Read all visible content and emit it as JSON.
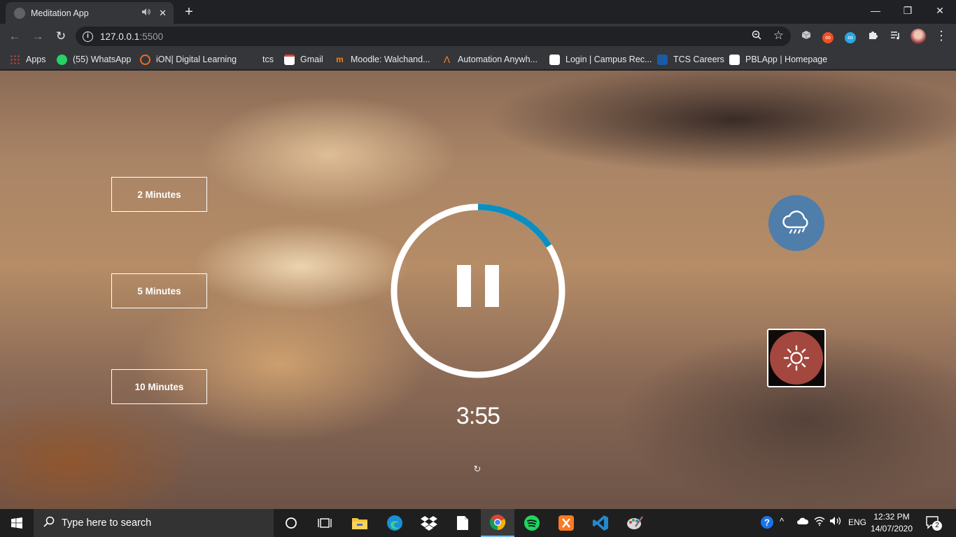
{
  "browser": {
    "tab_title": "Meditation App",
    "tab_audio_icon": "speaker-icon",
    "tab_close_glyph": "✕",
    "new_tab_glyph": "+",
    "window_controls": {
      "minimize": "—",
      "restore": "❐",
      "close": "✕"
    },
    "url_host": "127.0.0.1",
    "url_port": ":5500",
    "bookmarks": [
      {
        "label": "Apps",
        "color": "#e0e0e0"
      },
      {
        "label": "(55) WhatsApp",
        "color": "#25d366"
      },
      {
        "label": "iON| Digital Learning",
        "color": "#f26b21"
      },
      {
        "label": "tcs",
        "color": "#35363a"
      },
      {
        "label": "Gmail",
        "color": "#ea4335"
      },
      {
        "label": "Moodle: Walchand...",
        "color": "#f98012"
      },
      {
        "label": "Automation Anywh...",
        "color": "#f58220"
      },
      {
        "label": "Login | Campus Rec...",
        "color": "#ffffff"
      },
      {
        "label": "TCS Careers",
        "color": "#1a5aa6"
      },
      {
        "label": "PBLApp | Homepage",
        "color": "#ffffff"
      }
    ]
  },
  "app": {
    "time_options": [
      "2 Minutes",
      "5 Minutes",
      "10 Minutes"
    ],
    "timer_display": "3:55",
    "progress_fraction": 0.16,
    "progress_color": "#0b8fc1",
    "track_color": "#ffffff",
    "play_state_icon": "pause-icon",
    "sound_buttons": [
      {
        "name": "rain",
        "icon": "rain-cloud-icon",
        "color": "#4f7eaa"
      },
      {
        "name": "beach",
        "icon": "sun-icon",
        "color": "#a4473f"
      }
    ]
  },
  "taskbar": {
    "search_placeholder": "Type here to search",
    "language": "ENG",
    "time": "12:32 PM",
    "date": "14/07/2020",
    "notification_count": "2"
  }
}
